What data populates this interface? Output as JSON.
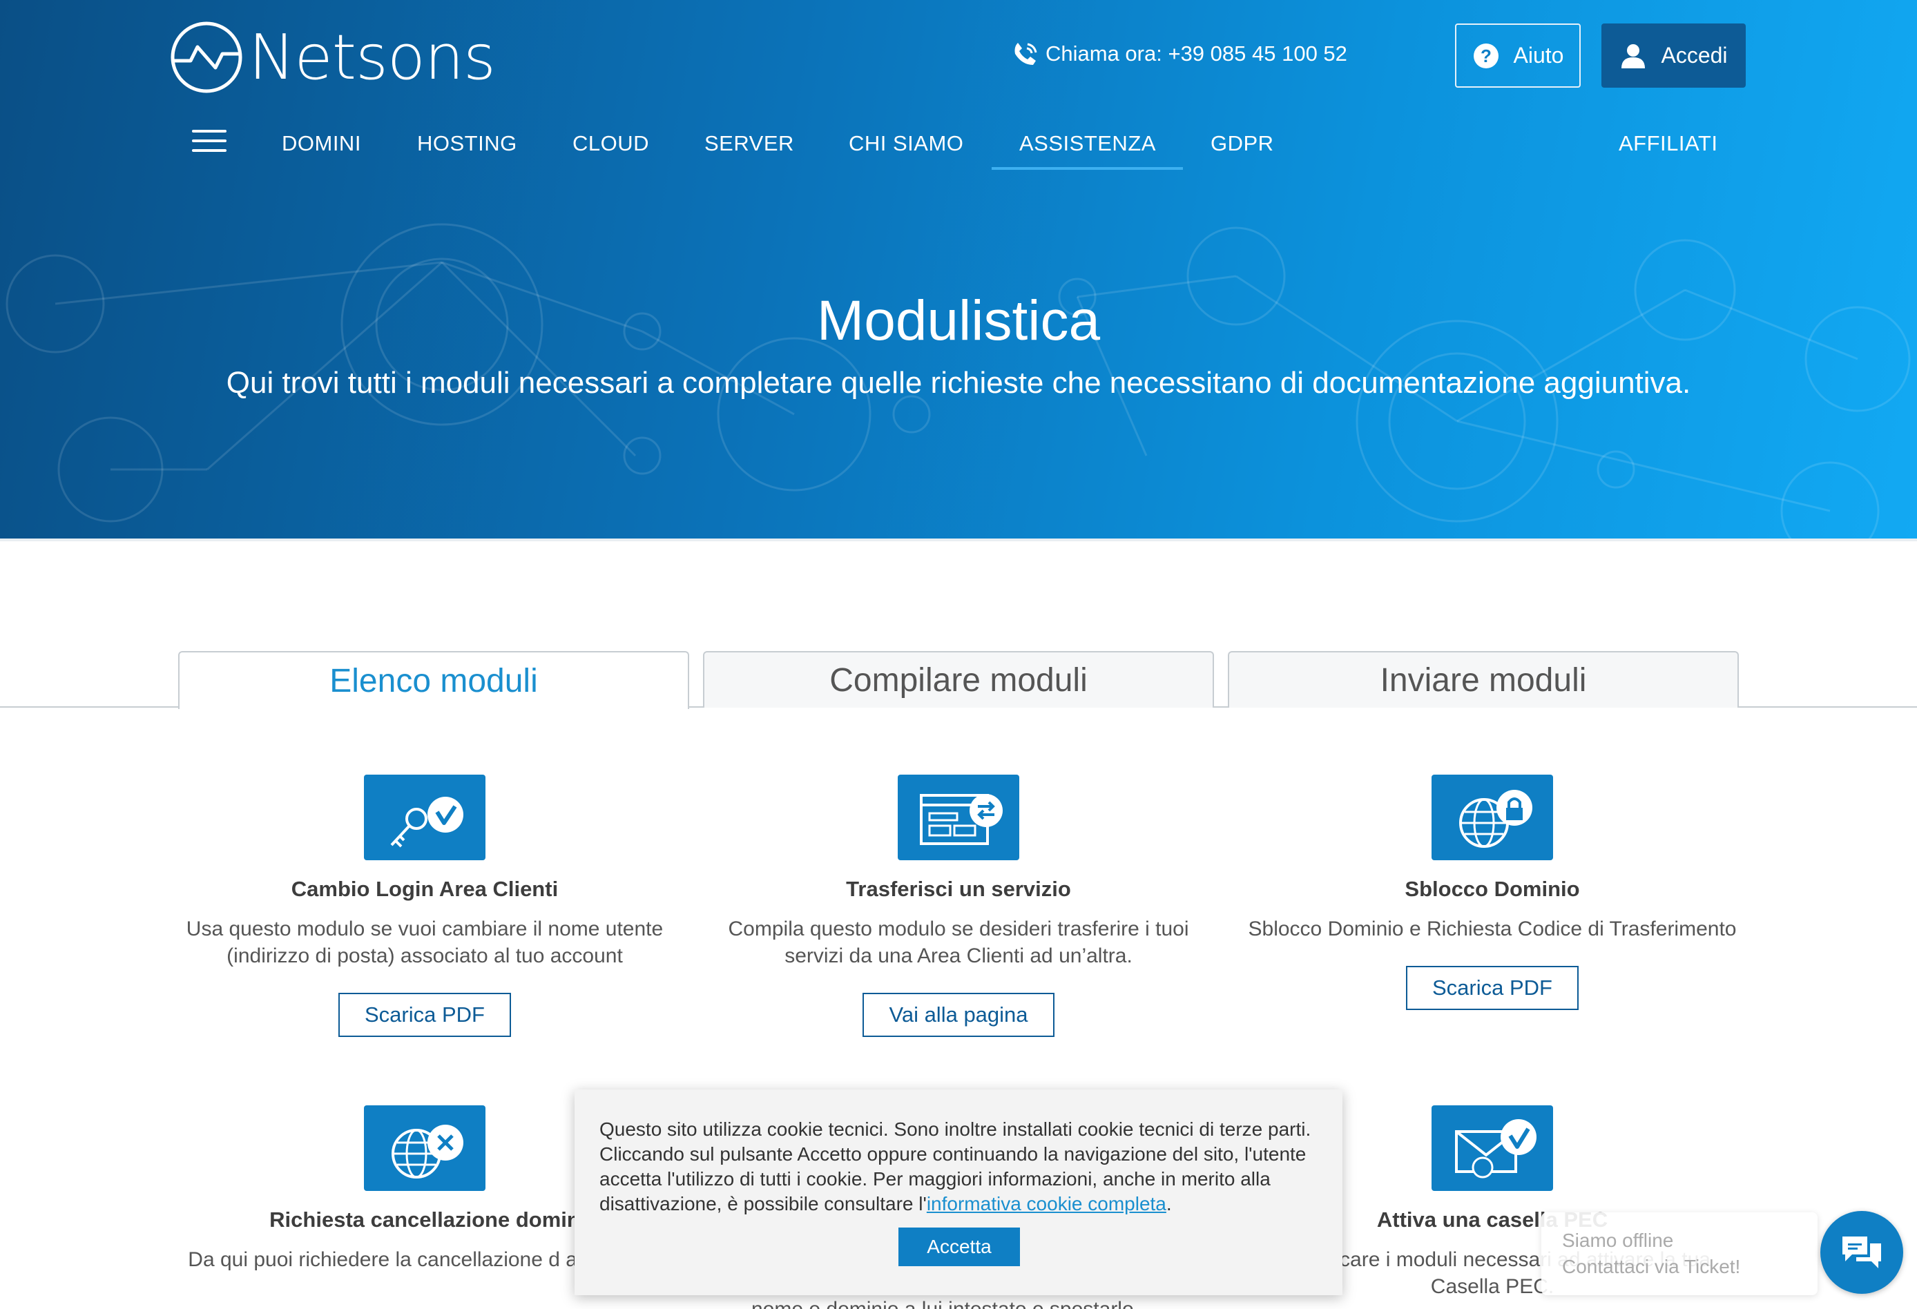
{
  "brand": {
    "name": "Netsons"
  },
  "header": {
    "phone_text": "Chiama ora: +39 085 45 100 52",
    "help_label": "Aiuto",
    "login_label": "Accedi"
  },
  "nav": {
    "items": [
      "DOMINI",
      "HOSTING",
      "CLOUD",
      "SERVER",
      "CHI SIAMO",
      "ASSISTENZA",
      "GDPR"
    ],
    "affiliates": "AFFILIATI",
    "active": "ASSISTENZA"
  },
  "hero": {
    "title": "Modulistica",
    "subtitle": "Qui trovi tutti i moduli necessari a completare quelle richieste che necessitano di documentazione aggiuntiva."
  },
  "tabs": [
    "Elenco moduli",
    "Compilare moduli",
    "Inviare moduli"
  ],
  "cards": [
    {
      "title": "Cambio Login Area Clienti",
      "desc": "Usa questo modulo se vuoi cambiare il nome utente (indirizzo di posta) associato al tuo account",
      "button": "Scarica PDF",
      "icon": "key-check-icon"
    },
    {
      "title": "Trasferisci un servizio",
      "desc": "Compila questo modulo se desideri trasferire i tuoi servizi da una Area Clienti ad un’altra.",
      "button": "Vai alla pagina",
      "icon": "window-transfer-icon"
    },
    {
      "title": "Sblocco Dominio",
      "desc": "Sblocco Dominio e Richiesta Codice di Trasferimento",
      "button": "Scarica PDF",
      "icon": "globe-lock-icon"
    },
    {
      "title": "Richiesta cancellazione domin",
      "desc": "Da qui puoi richiedere la cancellazione d a dominio.",
      "icon": "globe-x-icon"
    },
    {
      "title": "Attiva una casella PEC",
      "desc": "oi scaricare i moduli necessari ad attivare la tua Casella PEC.",
      "icon": "mail-check-icon"
    }
  ],
  "partial_text": "nome e dominio a lui intestato e spostarlo",
  "cookie": {
    "text": "Questo sito utilizza cookie tecnici. Sono inoltre installati cookie tecnici di terze parti. Cliccando sul pulsante Accetto oppure continuando la navigazione del sito, l'utente accetta l'utilizzo di tutti i cookie. Per maggiori informazioni, anche in merito alla disattivazione, è possibile consultare l'",
    "link": "informativa cookie completa",
    "after": ".",
    "accept": "Accetta"
  },
  "chat": {
    "status": "Siamo offline",
    "action": "Contattaci via Ticket!"
  },
  "colors": {
    "accent": "#0f7fc4",
    "dark_accent": "#0d5b96",
    "tab_active": "#1a8fcf"
  }
}
